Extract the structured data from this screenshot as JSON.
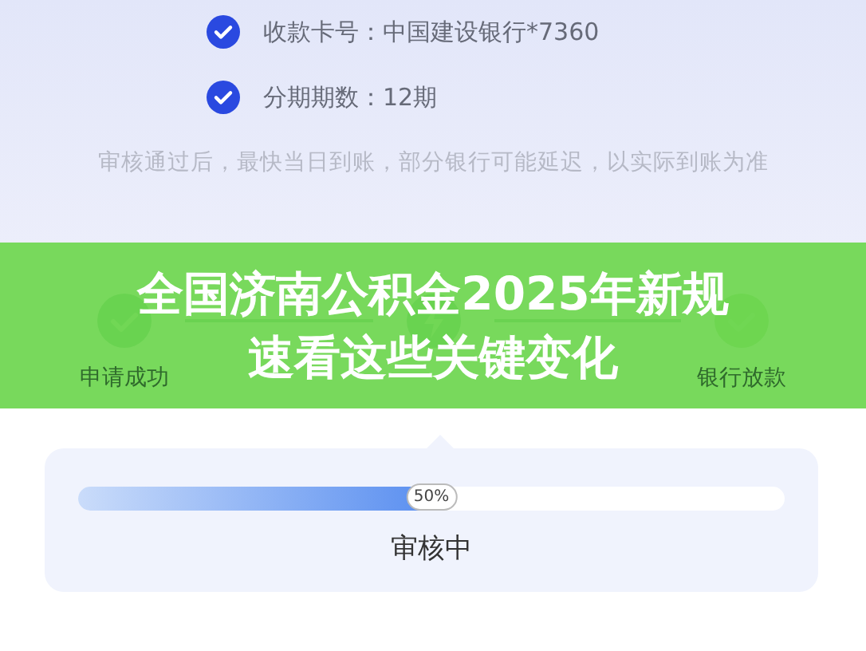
{
  "info_rows": [
    {
      "label": "收款卡号：中国建设银行*7360",
      "checked": true
    },
    {
      "label": "分期期数：12期",
      "checked": true
    }
  ],
  "note": "审核通过后，最快当日到账，部分银行可能延迟，以实际到账为准",
  "steps": [
    {
      "label": "申请成功",
      "kind": "done"
    },
    {
      "kind": "current"
    },
    {
      "label": "银行放款",
      "kind": "pending"
    }
  ],
  "banner": {
    "lines": [
      "全国济南公积金2025年新规",
      "速看这些关键变化"
    ]
  },
  "progress": {
    "level": 0.5,
    "reading": "50%",
    "status": "审核中"
  }
}
